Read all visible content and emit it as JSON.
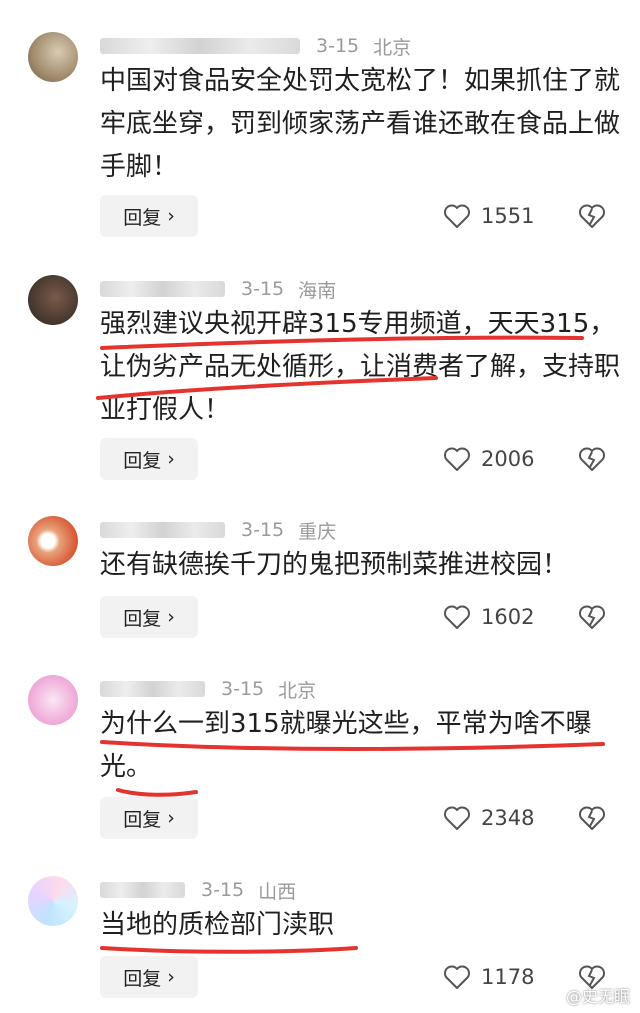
{
  "comments": [
    {
      "date": "3-15",
      "location": "北京",
      "text": "中国对食品安全处罚太宽松了！如果抓住了就牢底坐穿，罚到倾家荡产看谁还敢在食品上做手脚！",
      "reply_label": "回复",
      "likes": "1551"
    },
    {
      "date": "3-15",
      "location": "海南",
      "text": "强烈建议央视开辟315专用频道，天天315，让伪劣产品无处循形，让消费者了解，支持职业打假人！",
      "reply_label": "回复",
      "likes": "2006"
    },
    {
      "date": "3-15",
      "location": "重庆",
      "text": "还有缺德挨千刀的鬼把预制菜推进校园！",
      "reply_label": "回复",
      "likes": "1602"
    },
    {
      "date": "3-15",
      "location": "北京",
      "text": "为什么一到315就曝光这些，平常为啥不曝光。",
      "reply_label": "回复",
      "likes": "2348"
    },
    {
      "date": "3-15",
      "location": "山西",
      "text": "当地的质检部门渎职",
      "reply_label": "回复",
      "likes": "1178"
    }
  ],
  "watermark": "@史无眠",
  "colors": {
    "underline": "#e3342f",
    "reply_bg": "#f2f2f2",
    "meta": "#9a9a9a"
  },
  "icons": {
    "like": "heart-outline-icon",
    "dislike": "broken-heart-icon",
    "reply_arrow": "chevron-right-icon"
  }
}
